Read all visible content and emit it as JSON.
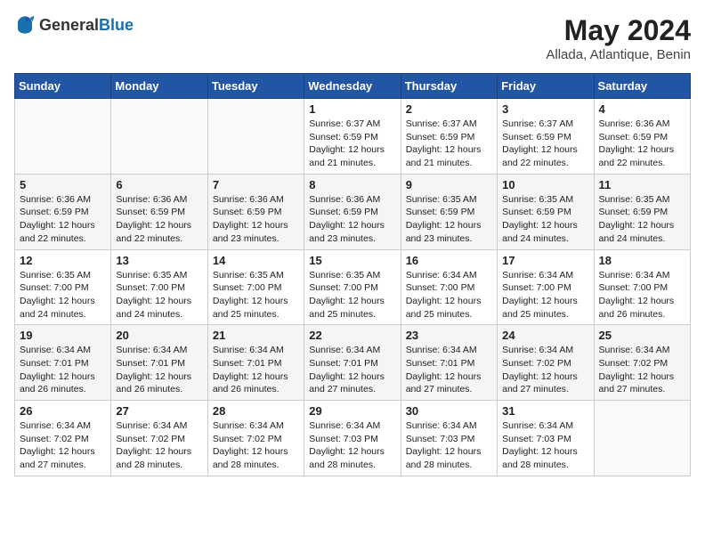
{
  "header": {
    "logo_general": "General",
    "logo_blue": "Blue",
    "title": "May 2024",
    "location": "Allada, Atlantique, Benin"
  },
  "calendar": {
    "days_of_week": [
      "Sunday",
      "Monday",
      "Tuesday",
      "Wednesday",
      "Thursday",
      "Friday",
      "Saturday"
    ],
    "weeks": [
      [
        {
          "day": "",
          "info": ""
        },
        {
          "day": "",
          "info": ""
        },
        {
          "day": "",
          "info": ""
        },
        {
          "day": "1",
          "info": "Sunrise: 6:37 AM\nSunset: 6:59 PM\nDaylight: 12 hours\nand 21 minutes."
        },
        {
          "day": "2",
          "info": "Sunrise: 6:37 AM\nSunset: 6:59 PM\nDaylight: 12 hours\nand 21 minutes."
        },
        {
          "day": "3",
          "info": "Sunrise: 6:37 AM\nSunset: 6:59 PM\nDaylight: 12 hours\nand 22 minutes."
        },
        {
          "day": "4",
          "info": "Sunrise: 6:36 AM\nSunset: 6:59 PM\nDaylight: 12 hours\nand 22 minutes."
        }
      ],
      [
        {
          "day": "5",
          "info": "Sunrise: 6:36 AM\nSunset: 6:59 PM\nDaylight: 12 hours\nand 22 minutes."
        },
        {
          "day": "6",
          "info": "Sunrise: 6:36 AM\nSunset: 6:59 PM\nDaylight: 12 hours\nand 22 minutes."
        },
        {
          "day": "7",
          "info": "Sunrise: 6:36 AM\nSunset: 6:59 PM\nDaylight: 12 hours\nand 23 minutes."
        },
        {
          "day": "8",
          "info": "Sunrise: 6:36 AM\nSunset: 6:59 PM\nDaylight: 12 hours\nand 23 minutes."
        },
        {
          "day": "9",
          "info": "Sunrise: 6:35 AM\nSunset: 6:59 PM\nDaylight: 12 hours\nand 23 minutes."
        },
        {
          "day": "10",
          "info": "Sunrise: 6:35 AM\nSunset: 6:59 PM\nDaylight: 12 hours\nand 24 minutes."
        },
        {
          "day": "11",
          "info": "Sunrise: 6:35 AM\nSunset: 6:59 PM\nDaylight: 12 hours\nand 24 minutes."
        }
      ],
      [
        {
          "day": "12",
          "info": "Sunrise: 6:35 AM\nSunset: 7:00 PM\nDaylight: 12 hours\nand 24 minutes."
        },
        {
          "day": "13",
          "info": "Sunrise: 6:35 AM\nSunset: 7:00 PM\nDaylight: 12 hours\nand 24 minutes."
        },
        {
          "day": "14",
          "info": "Sunrise: 6:35 AM\nSunset: 7:00 PM\nDaylight: 12 hours\nand 25 minutes."
        },
        {
          "day": "15",
          "info": "Sunrise: 6:35 AM\nSunset: 7:00 PM\nDaylight: 12 hours\nand 25 minutes."
        },
        {
          "day": "16",
          "info": "Sunrise: 6:34 AM\nSunset: 7:00 PM\nDaylight: 12 hours\nand 25 minutes."
        },
        {
          "day": "17",
          "info": "Sunrise: 6:34 AM\nSunset: 7:00 PM\nDaylight: 12 hours\nand 25 minutes."
        },
        {
          "day": "18",
          "info": "Sunrise: 6:34 AM\nSunset: 7:00 PM\nDaylight: 12 hours\nand 26 minutes."
        }
      ],
      [
        {
          "day": "19",
          "info": "Sunrise: 6:34 AM\nSunset: 7:01 PM\nDaylight: 12 hours\nand 26 minutes."
        },
        {
          "day": "20",
          "info": "Sunrise: 6:34 AM\nSunset: 7:01 PM\nDaylight: 12 hours\nand 26 minutes."
        },
        {
          "day": "21",
          "info": "Sunrise: 6:34 AM\nSunset: 7:01 PM\nDaylight: 12 hours\nand 26 minutes."
        },
        {
          "day": "22",
          "info": "Sunrise: 6:34 AM\nSunset: 7:01 PM\nDaylight: 12 hours\nand 27 minutes."
        },
        {
          "day": "23",
          "info": "Sunrise: 6:34 AM\nSunset: 7:01 PM\nDaylight: 12 hours\nand 27 minutes."
        },
        {
          "day": "24",
          "info": "Sunrise: 6:34 AM\nSunset: 7:02 PM\nDaylight: 12 hours\nand 27 minutes."
        },
        {
          "day": "25",
          "info": "Sunrise: 6:34 AM\nSunset: 7:02 PM\nDaylight: 12 hours\nand 27 minutes."
        }
      ],
      [
        {
          "day": "26",
          "info": "Sunrise: 6:34 AM\nSunset: 7:02 PM\nDaylight: 12 hours\nand 27 minutes."
        },
        {
          "day": "27",
          "info": "Sunrise: 6:34 AM\nSunset: 7:02 PM\nDaylight: 12 hours\nand 28 minutes."
        },
        {
          "day": "28",
          "info": "Sunrise: 6:34 AM\nSunset: 7:02 PM\nDaylight: 12 hours\nand 28 minutes."
        },
        {
          "day": "29",
          "info": "Sunrise: 6:34 AM\nSunset: 7:03 PM\nDaylight: 12 hours\nand 28 minutes."
        },
        {
          "day": "30",
          "info": "Sunrise: 6:34 AM\nSunset: 7:03 PM\nDaylight: 12 hours\nand 28 minutes."
        },
        {
          "day": "31",
          "info": "Sunrise: 6:34 AM\nSunset: 7:03 PM\nDaylight: 12 hours\nand 28 minutes."
        },
        {
          "day": "",
          "info": ""
        }
      ]
    ]
  }
}
